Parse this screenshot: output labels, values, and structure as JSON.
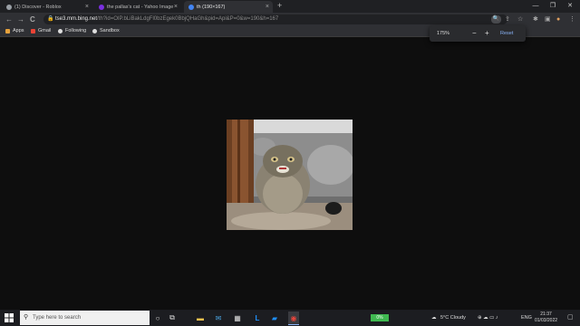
{
  "tabs": [
    {
      "title": "(1) Discover - Roblox",
      "close": "×",
      "favicon_color": "#9aa0a6"
    },
    {
      "title": "the pallas's cat - Yahoo Image Se",
      "close": "×",
      "favicon_color": "#7b2fe0"
    },
    {
      "title": "th (190×167)",
      "close": "×",
      "favicon_color": "#4285f4"
    }
  ],
  "new_tab": "+",
  "window_controls": {
    "minimize": "—",
    "maximize": "❐",
    "close": "✕"
  },
  "nav": {
    "back": "←",
    "forward": "→",
    "reload": "C",
    "home": "⌂"
  },
  "address": {
    "lock": "🔒",
    "domain": "tse3.mm.bing.net",
    "path": "/th?id=OIP.bLiBakLdgFl0bzEgek0BbjQHaGh&pid=Api&P=0&w=190&h=167"
  },
  "toolbar_icons": {
    "zoom": "🔍",
    "share": "⇪",
    "star": "☆",
    "extensions": "✱",
    "sidebar": "▣",
    "profile": "●",
    "menu": "⋮"
  },
  "bookmarks": [
    {
      "label": "Apps",
      "icon_color": "#e6a23c"
    },
    {
      "label": "Gmail",
      "icon_color": "#ea4335"
    },
    {
      "label": "Following",
      "icon_color": "#ddd"
    },
    {
      "label": "Sandbox",
      "icon_color": "#ddd"
    }
  ],
  "zoom_popup": {
    "level": "175%",
    "minus": "−",
    "plus": "+",
    "reset": "Reset"
  },
  "taskbar": {
    "search_placeholder": "Type here to search",
    "search_icon": "⚲",
    "apps": [
      {
        "name": "cortana-icon",
        "glyph": "○",
        "color": "#ddd"
      },
      {
        "name": "task-view-icon",
        "glyph": "⧉",
        "color": "#ddd"
      },
      {
        "name": "file-explorer-icon",
        "glyph": "▬",
        "color": "#f2c14e"
      },
      {
        "name": "mail-icon",
        "glyph": "✉",
        "color": "#4aa3df"
      },
      {
        "name": "store-icon",
        "glyph": "▦",
        "color": "#ddd"
      },
      {
        "name": "app-l-icon",
        "glyph": "L",
        "color": "#1e90ff"
      },
      {
        "name": "windows-app-icon",
        "glyph": "▰",
        "color": "#1e90ff"
      },
      {
        "name": "chrome-icon",
        "glyph": "◉",
        "color": "#e8453c"
      }
    ],
    "battery_percent": "0%",
    "weather": "5°C  Cloudy",
    "language": "ENG",
    "time": "21:37",
    "date": "01/03/2022"
  }
}
